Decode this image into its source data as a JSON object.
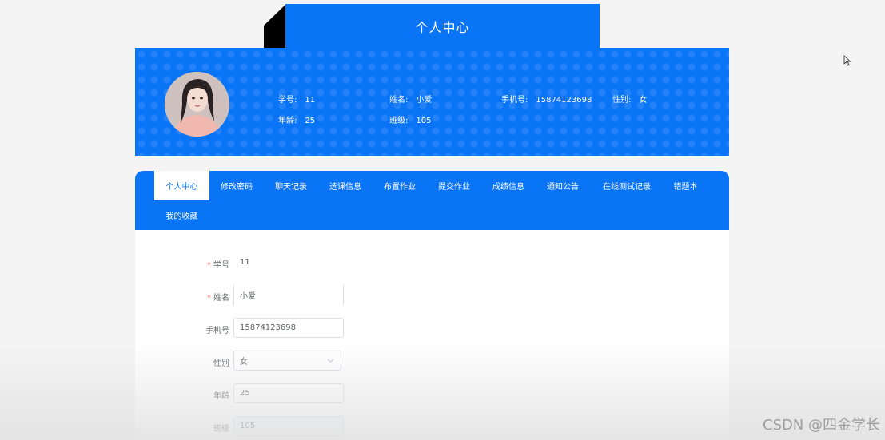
{
  "header": {
    "title": "个人中心"
  },
  "profile": {
    "student_id_label": "学号:",
    "student_id": "11",
    "name_label": "姓名:",
    "name": "小爱",
    "phone_label": "手机号:",
    "phone": "15874123698",
    "gender_label": "性别:",
    "gender": "女",
    "age_label": "年龄:",
    "age": "25",
    "class_label": "班级:",
    "class": "105"
  },
  "tabs": [
    {
      "label": "个人中心",
      "active": true
    },
    {
      "label": "修改密码"
    },
    {
      "label": "聊天记录"
    },
    {
      "label": "选课信息"
    },
    {
      "label": "布置作业"
    },
    {
      "label": "提交作业"
    },
    {
      "label": "成绩信息"
    },
    {
      "label": "通知公告"
    },
    {
      "label": "在线测试记录"
    },
    {
      "label": "错题本"
    },
    {
      "label": "我的收藏"
    }
  ],
  "form": {
    "required_mark": "*",
    "student_id": {
      "label": "学号",
      "value": "11"
    },
    "name": {
      "label": "姓名",
      "value": "小爱"
    },
    "phone": {
      "label": "手机号",
      "value": "15874123698"
    },
    "gender": {
      "label": "性别",
      "value": "女"
    },
    "age": {
      "label": "年龄",
      "value": "25"
    },
    "class": {
      "label": "班级",
      "value": "105"
    }
  },
  "watermark": "CSDN @四金学长",
  "colors": {
    "primary": "#0a74f7",
    "required": "#f56c6c"
  }
}
